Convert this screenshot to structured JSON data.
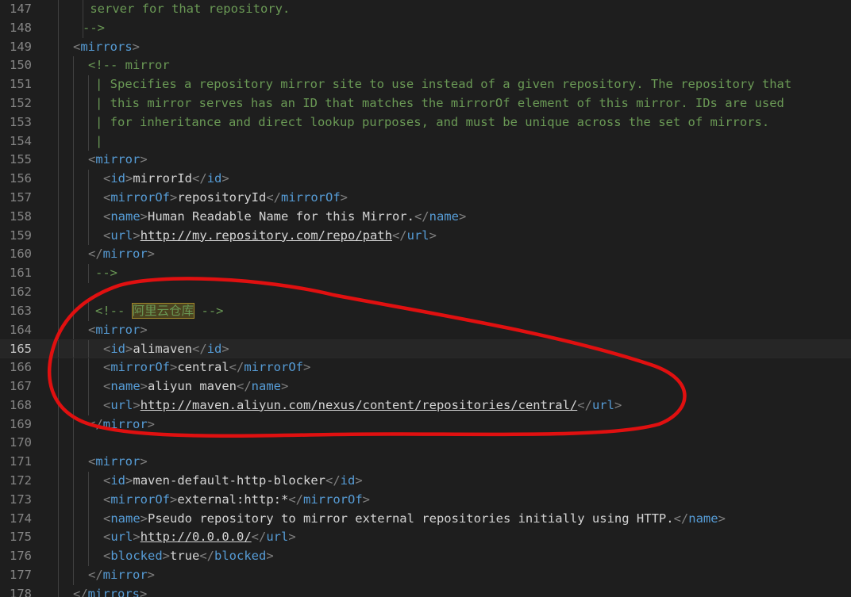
{
  "editor": {
    "lines": [
      {
        "num": "147",
        "text": " server for that repository."
      },
      {
        "num": "148",
        "text": "-->"
      },
      {
        "num": "149",
        "text": "<mirrors>"
      },
      {
        "num": "150",
        "text": "<!-- mirror"
      },
      {
        "num": "151",
        "text": "| Specifies a repository mirror site to use instead of a given repository. The repository that"
      },
      {
        "num": "152",
        "text": "| this mirror serves has an ID that matches the mirrorOf element of this mirror. IDs are used"
      },
      {
        "num": "153",
        "text": "| for inheritance and direct lookup purposes, and must be unique across the set of mirrors."
      },
      {
        "num": "154",
        "text": "|"
      },
      {
        "num": "155",
        "text": "<mirror>"
      },
      {
        "num": "156",
        "text": "<id>mirrorId</id>"
      },
      {
        "num": "157",
        "text": "<mirrorOf>repositoryId</mirrorOf>"
      },
      {
        "num": "158",
        "text": "<name>Human Readable Name for this Mirror.</name>"
      },
      {
        "num": "159",
        "text": "<url>http://my.repository.com/repo/path</url>"
      },
      {
        "num": "160",
        "text": "</mirror>"
      },
      {
        "num": "161",
        "text": "-->"
      },
      {
        "num": "162",
        "text": ""
      },
      {
        "num": "163",
        "text": "<!-- 阿里云仓库 -->"
      },
      {
        "num": "164",
        "text": "<mirror>"
      },
      {
        "num": "165",
        "text": "<id>alimaven</id>"
      },
      {
        "num": "166",
        "text": "<mirrorOf>central</mirrorOf>"
      },
      {
        "num": "167",
        "text": "<name>aliyun maven</name>"
      },
      {
        "num": "168",
        "text": "<url>http://maven.aliyun.com/nexus/content/repositories/central/</url>"
      },
      {
        "num": "169",
        "text": "</mirror>"
      },
      {
        "num": "170",
        "text": ""
      },
      {
        "num": "171",
        "text": "<mirror>"
      },
      {
        "num": "172",
        "text": "<id>maven-default-http-blocker</id>"
      },
      {
        "num": "173",
        "text": "<mirrorOf>external:http:*</mirrorOf>"
      },
      {
        "num": "174",
        "text": "<name>Pseudo repository to mirror external repositories initially using HTTP.</name>"
      },
      {
        "num": "175",
        "text": "<url>http://0.0.0.0/</url>"
      },
      {
        "num": "176",
        "text": "<blocked>true</blocked>"
      },
      {
        "num": "177",
        "text": "</mirror>"
      },
      {
        "num": "178",
        "text": "</mirrors>"
      }
    ],
    "current_line": "165",
    "highlighted_comment": "阿里云仓库"
  },
  "colors": {
    "background": "#1e1e1e",
    "tag": "#569cd6",
    "comment": "#6a9955",
    "annotation": "#e01010"
  }
}
